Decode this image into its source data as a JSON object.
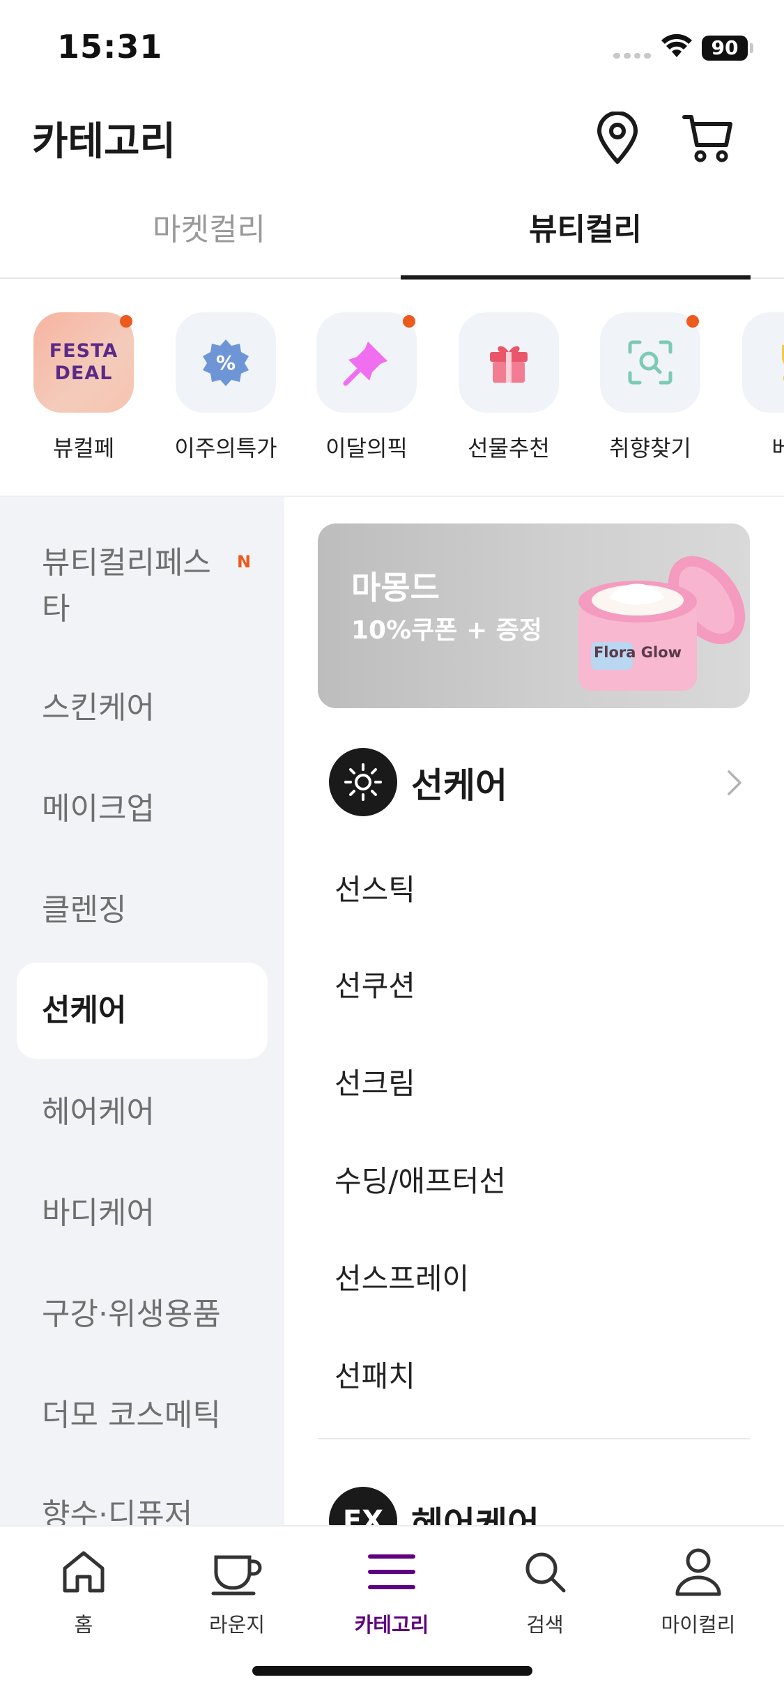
{
  "status_bar": {
    "time": "15:31",
    "battery": "90"
  },
  "header": {
    "title": "카테고리"
  },
  "tabs": [
    {
      "label": "마켓컬리",
      "active": false
    },
    {
      "label": "뷰티컬리",
      "active": true
    }
  ],
  "shortcuts": [
    {
      "label": "뷰컬페",
      "icon": "festa-deal-icon",
      "badge_text": [
        "FESTA",
        "DEAL"
      ],
      "dot": true
    },
    {
      "label": "이주의특가",
      "icon": "percent-badge-icon",
      "dot": false
    },
    {
      "label": "이달의픽",
      "icon": "pin-icon",
      "dot": true
    },
    {
      "label": "선물추천",
      "icon": "gift-icon",
      "dot": false
    },
    {
      "label": "취향찾기",
      "icon": "scan-search-icon",
      "dot": true
    },
    {
      "label": "베스",
      "icon": "trophy-icon",
      "dot": false
    }
  ],
  "left_menu": {
    "items": [
      {
        "label": "뷰티컬리페스타",
        "line1": "뷰티컬리페스",
        "line2": "타",
        "badge": "N"
      },
      {
        "label": "스킨케어"
      },
      {
        "label": "메이크업"
      },
      {
        "label": "클렌징"
      },
      {
        "label": "선케어",
        "active": true
      },
      {
        "label": "헤어케어"
      },
      {
        "label": "바디케어"
      },
      {
        "label": "구강·위생용품"
      },
      {
        "label": "더모 코스메틱"
      },
      {
        "label": "향수·디퓨저"
      }
    ]
  },
  "banner": {
    "title": "마몽드",
    "subtitle": "10%쿠폰 + 증정",
    "product_text": "Flora Glow"
  },
  "category": {
    "title": "선케어",
    "icon": "sun-icon",
    "subcategories": [
      "선스틱",
      "선쿠션",
      "선크림",
      "수딩/애프터선",
      "선스프레이",
      "선패치"
    ]
  },
  "next_category": {
    "title": "헤어케어",
    "icon_text": "EX"
  },
  "bottom_nav": [
    {
      "label": "홈",
      "icon": "home-icon",
      "active": false
    },
    {
      "label": "라운지",
      "icon": "cup-icon",
      "active": false
    },
    {
      "label": "카테고리",
      "icon": "menu-icon",
      "active": true
    },
    {
      "label": "검색",
      "icon": "search-icon",
      "active": false
    },
    {
      "label": "마이컬리",
      "icon": "user-icon",
      "active": false
    }
  ],
  "colors": {
    "accent": "#5f0080",
    "notification": "#ec5a1e",
    "menu_bg": "#f1f3f7"
  }
}
